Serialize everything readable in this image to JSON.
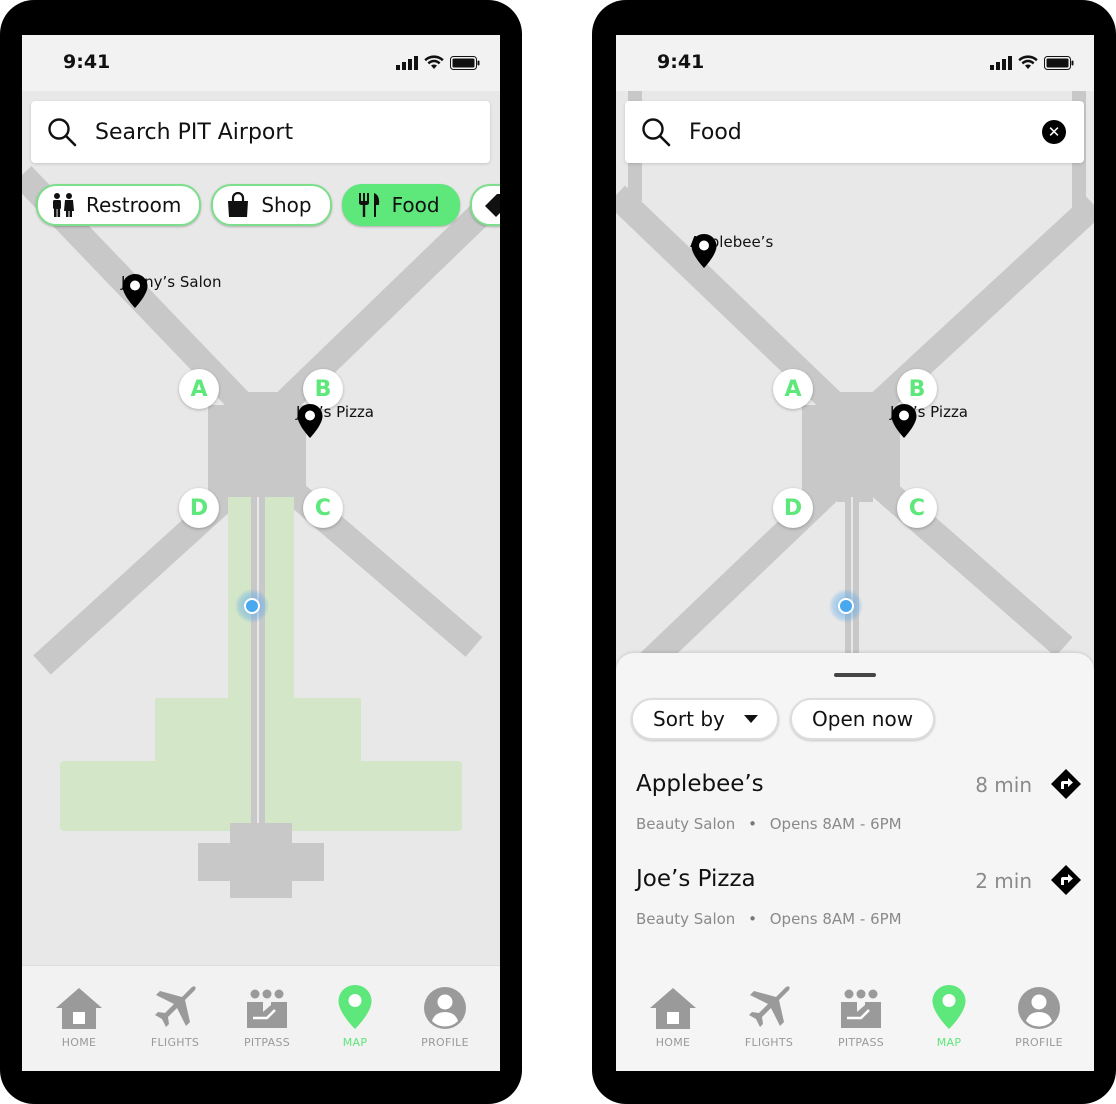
{
  "status": {
    "time": "9:41"
  },
  "left": {
    "search": {
      "placeholder": "Search PIT Airport"
    },
    "chips": [
      {
        "label": "Restroom",
        "icon": "restroom-icon"
      },
      {
        "label": "Shop",
        "icon": "shopping-bag-icon"
      },
      {
        "label": "Food",
        "icon": "fork-knife-icon",
        "active": true
      },
      {
        "label": "",
        "icon": "tag-icon"
      }
    ],
    "pins": [
      {
        "label": "Jenny’s Salon"
      },
      {
        "label": "Joe’s Pizza"
      }
    ]
  },
  "gates": [
    "A",
    "B",
    "C",
    "D"
  ],
  "right": {
    "search": {
      "value": "Food"
    },
    "pins": [
      {
        "label": "Applebee’s"
      },
      {
        "label": "Joe’s Pizza"
      }
    ],
    "sheet": {
      "sort_label": "Sort by",
      "open_now_label": "Open now",
      "results": [
        {
          "name": "Applebee’s",
          "time": "8 min",
          "category": "Beauty Salon",
          "hours": "Opens 8AM - 6PM"
        },
        {
          "name": "Joe’s Pizza",
          "time": "2 min",
          "category": "Beauty Salon",
          "hours": "Opens 8AM - 6PM"
        }
      ]
    }
  },
  "tabs": [
    {
      "label": "HOME",
      "icon": "home-icon"
    },
    {
      "label": "FLIGHTS",
      "icon": "airplane-icon"
    },
    {
      "label": "PITPASS",
      "icon": "pitpass-icon"
    },
    {
      "label": "MAP",
      "icon": "map-pin-icon",
      "active": true
    },
    {
      "label": "PROFILE",
      "icon": "profile-icon"
    }
  ],
  "colors": {
    "accent": "#5ee77a",
    "walkway": "#c8c8c8",
    "route": "#d4e6c8",
    "map_bg": "#e8e8e8"
  }
}
